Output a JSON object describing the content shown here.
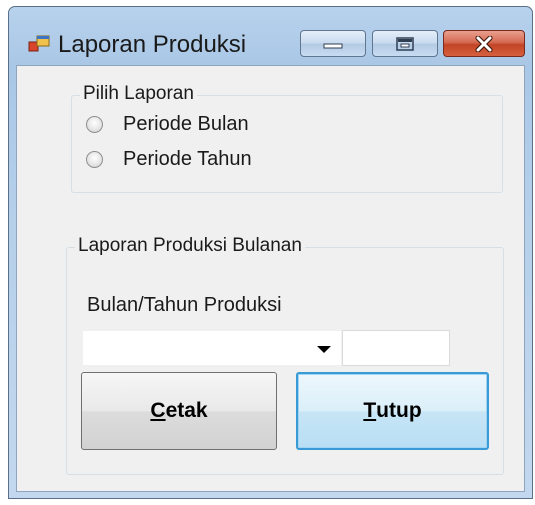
{
  "window": {
    "title": "Laporan Produksi",
    "controls": {
      "minimize": "minimize-icon",
      "maximize": "restore-icon",
      "close": "close-icon"
    }
  },
  "group_report_type": {
    "legend": "Pilih Laporan",
    "options": [
      {
        "label": "Periode Bulan",
        "checked": false
      },
      {
        "label": "Periode Tahun",
        "checked": false
      }
    ]
  },
  "group_monthly": {
    "legend": "Laporan Produksi Bulanan",
    "period_label": "Bulan/Tahun Produksi",
    "month_combo_value": "",
    "year_textbox_value": ""
  },
  "buttons": {
    "cetak": {
      "mnemonic": "C",
      "rest": "etak"
    },
    "tutup": {
      "mnemonic": "T",
      "rest": "utup"
    }
  },
  "colors": {
    "frame": "#b5cfea",
    "client": "#f0f0f0",
    "close_button": "#c24426",
    "focus_button": "#3a9ad5"
  }
}
